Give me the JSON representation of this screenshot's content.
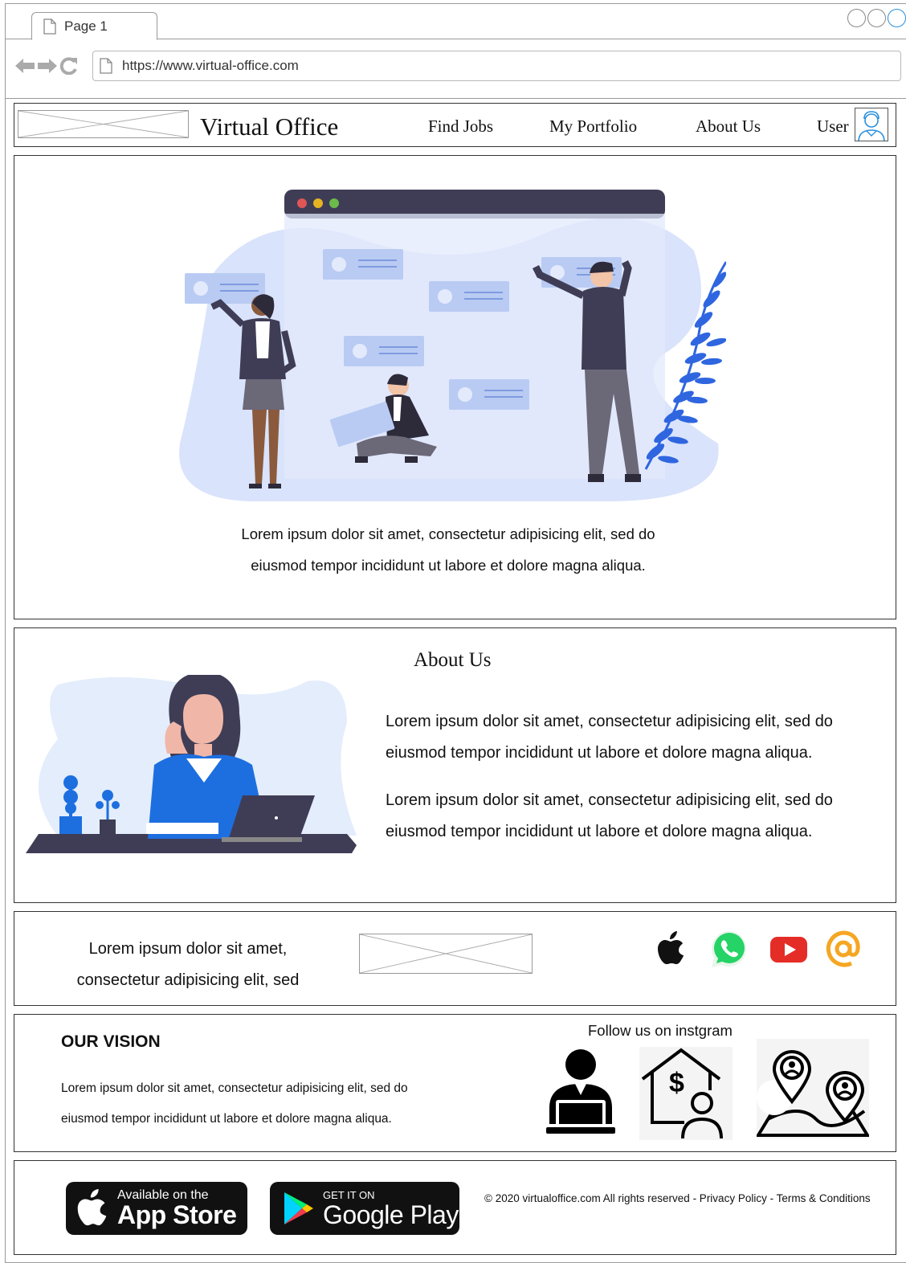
{
  "browser": {
    "tab_label": "Page 1",
    "url": "https://www.virtual-office.com"
  },
  "header": {
    "brand": "Virtual Office",
    "nav": [
      "Find Jobs",
      "My Portfolio",
      "About Us"
    ],
    "user_label": "User"
  },
  "hero": {
    "text": "Lorem ipsum dolor sit amet, consectetur adipisicing elit, sed do eiusmod tempor incididunt ut labore et dolore magna aliqua."
  },
  "about": {
    "title": "About Us",
    "paragraphs": [
      "Lorem ipsum dolor sit amet, consectetur adipisicing elit, sed do eiusmod tempor incididunt ut labore et dolore magna aliqua.",
      "Lorem ipsum dolor sit amet, consectetur adipisicing elit, sed do eiusmod tempor incididunt ut labore et dolore magna aliqua."
    ]
  },
  "strip": {
    "text": "Lorem ipsum dolor sit amet, consectetur adipisicing elit, sed",
    "social_icons": [
      "apple-icon",
      "whatsapp-icon",
      "youtube-icon",
      "email-at-icon"
    ]
  },
  "vision": {
    "title": "OUR VISION",
    "text": "Lorem ipsum dolor sit amet, consectetur adipisicing elit, sed do eiusmod tempor incididunt ut labore et dolore magna aliqua.",
    "follow_label": "Follow us on instgram",
    "instagram_icons": [
      "remote-worker-icon",
      "house-finance-icon",
      "map-location-icon"
    ]
  },
  "footer": {
    "app_store": {
      "small": "Available on the",
      "big": "App Store"
    },
    "google_play": {
      "small": "GET IT ON",
      "big": "Google Play"
    },
    "copyright": "© 2020 virtualoffice.com All rights reserved - Privacy Policy - Terms & Conditions"
  },
  "colors": {
    "border": "#333333",
    "accent_blue": "#2a8fdc",
    "illustration_light": "#d9e3fb",
    "illustration_dark": "#3f3d56",
    "plant_blue": "#2f66e0",
    "shirt_blue": "#1d6fe0"
  }
}
